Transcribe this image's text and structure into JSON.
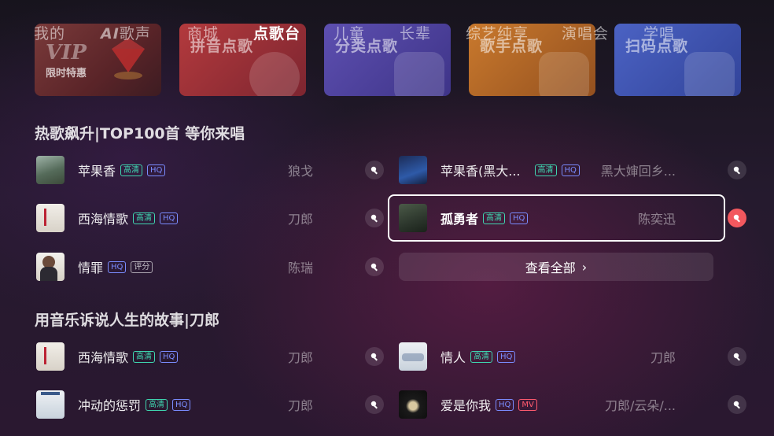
{
  "nav": {
    "items": [
      {
        "label": "我的"
      },
      {
        "label": "歌声",
        "logo": "AI"
      },
      {
        "label": "商城"
      },
      {
        "label": "点歌台",
        "active": true
      },
      {
        "label": "儿童"
      },
      {
        "label": "长辈"
      },
      {
        "label": "综艺纯享"
      },
      {
        "label": "演唱会"
      },
      {
        "label": "学唱"
      }
    ]
  },
  "cards": {
    "vip": {
      "big": "VIP",
      "small": "限时特惠",
      "icon": "gem-icon"
    },
    "pinyin": {
      "label": "拼音点歌",
      "icon": "pinyin-icon"
    },
    "fenlei": {
      "label": "分类点歌",
      "icon": "grid-icon"
    },
    "geshou": {
      "label": "歌手点歌",
      "icon": "person-icon"
    },
    "saoma": {
      "label": "扫码点歌",
      "icon": "qr-icon"
    }
  },
  "section1": {
    "title": "热歌飙升|TOP100首 等你来唱",
    "left": [
      {
        "title": "苹果香",
        "badges": [
          "高清",
          "HQ"
        ],
        "artist": "狼戈"
      },
      {
        "title": "西海情歌",
        "badges": [
          "高清",
          "HQ"
        ],
        "artist": "刀郎"
      },
      {
        "title": "情罪",
        "badges": [
          "HQ",
          "评分"
        ],
        "artist": "陈瑞"
      }
    ],
    "right": [
      {
        "title": "苹果香(黑大...",
        "badges": [
          "高清",
          "HQ"
        ],
        "artist": "黑大婶回乡..."
      },
      {
        "title": "孤勇者",
        "badges": [
          "高清",
          "HQ"
        ],
        "artist": "陈奕迅",
        "selected": true
      }
    ],
    "view_all": "查看全部",
    "view_all_chevron": "›"
  },
  "section2": {
    "title": "用音乐诉说人生的故事|刀郎",
    "left": [
      {
        "title": "西海情歌",
        "badges": [
          "高清",
          "HQ"
        ],
        "artist": "刀郎"
      },
      {
        "title": "冲动的惩罚",
        "badges": [
          "高清",
          "HQ"
        ],
        "artist": "刀郎"
      }
    ],
    "right": [
      {
        "title": "情人",
        "badges": [
          "高清",
          "HQ"
        ],
        "artist": "刀郎"
      },
      {
        "title": "爱是你我",
        "badges": [
          "HQ",
          "MV"
        ],
        "artist": "刀郎/云朵/..."
      }
    ]
  },
  "colors": {
    "accent": "#f2585e",
    "hd": "#3fd6b0",
    "hq": "#7a8cff",
    "mv": "#ff5a6e"
  }
}
